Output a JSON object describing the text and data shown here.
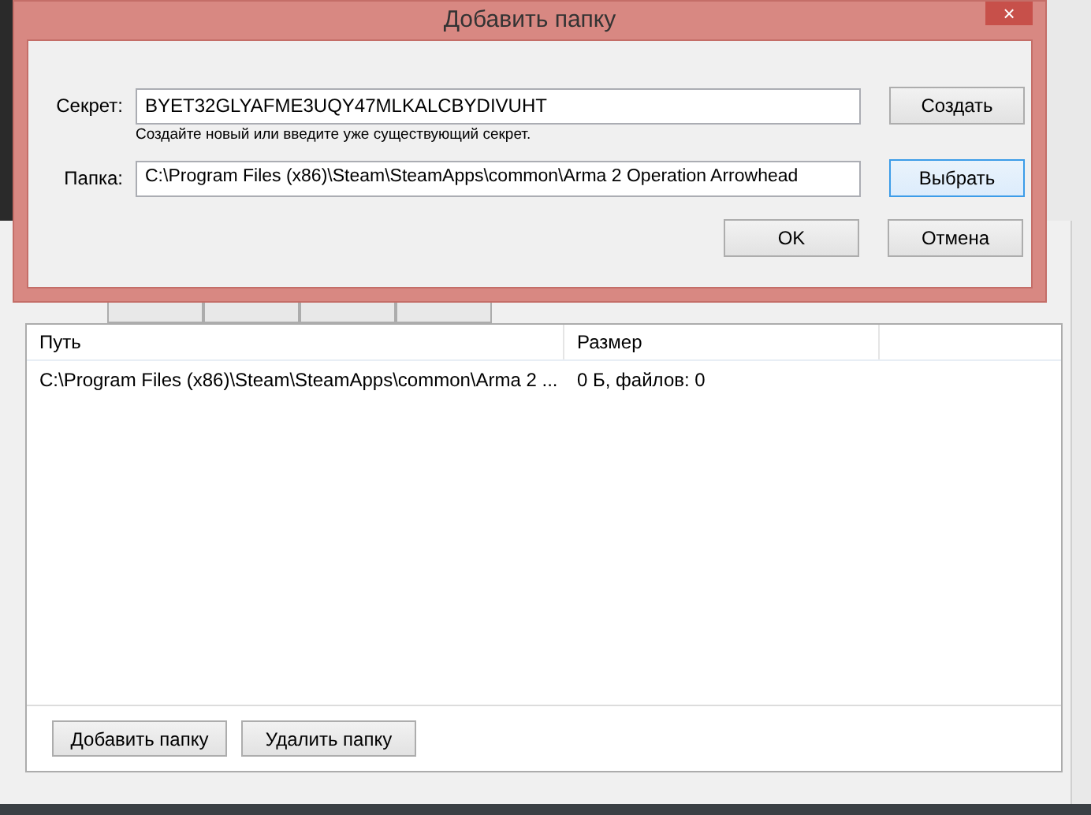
{
  "dialog": {
    "title": "Добавить папку",
    "close": "×",
    "secret": {
      "label": "Секрет:",
      "value": "BYET32GLYAFME3UQY47MLKALCBYDIVUHT",
      "hint": "Создайте новый или введите уже существующий секрет.",
      "button": "Создать"
    },
    "folder": {
      "label": "Папка:",
      "value": "C:\\Program Files (x86)\\Steam\\SteamApps\\common\\Arma 2 Operation Arrowhead",
      "button": "Выбрать",
      "button_focused": true
    },
    "buttons": [
      "OK",
      "Отмена"
    ]
  },
  "main": {
    "table": {
      "columns": [
        "Путь",
        "Размер"
      ],
      "rows": [
        {
          "path": "C:\\Program Files (x86)\\Steam\\SteamApps\\common\\Arma 2 ...",
          "size": "0 Б, файлов: 0"
        }
      ]
    },
    "buttons": [
      "Добавить папку",
      "Удалить папку"
    ]
  }
}
